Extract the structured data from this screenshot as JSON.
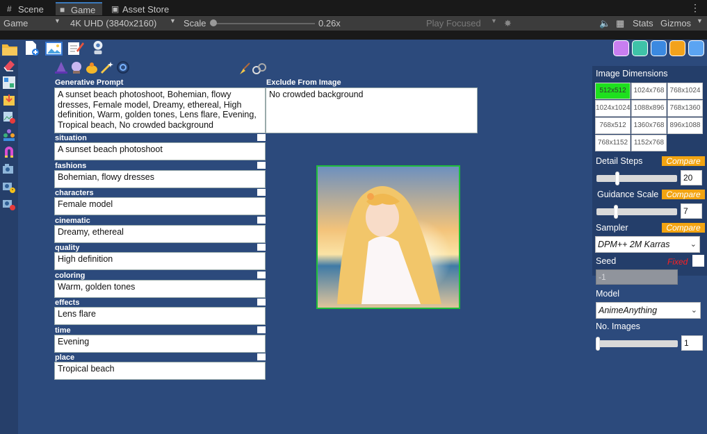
{
  "tabs": [
    {
      "label": "Scene",
      "icon": "grid-icon"
    },
    {
      "label": "Game",
      "icon": "gamepad-icon"
    },
    {
      "label": "Asset Store",
      "icon": "store-icon"
    }
  ],
  "toolbar": {
    "display": "Game",
    "resolution": "4K UHD (3840x2160)",
    "scale_label": "Scale",
    "scale_value": "0.26x",
    "play_focused": "Play Focused",
    "stats": "Stats",
    "gizmos": "Gizmos"
  },
  "prompt": {
    "title": "Generative Prompt",
    "text": "A sunset beach photoshoot, Bohemian, flowy dresses, Female model, Dreamy, ethereal, High definition, Warm, golden tones, Lens flare, Evening, Tropical beach, No crowded background"
  },
  "exclude": {
    "title": "Exclude From Image",
    "text": "No crowded background"
  },
  "fields": [
    {
      "label": "situation",
      "value": "A sunset beach photoshoot"
    },
    {
      "label": "fashions",
      "value": "Bohemian, flowy dresses"
    },
    {
      "label": "characters",
      "value": "Female model"
    },
    {
      "label": "cinematic",
      "value": "Dreamy, ethereal"
    },
    {
      "label": "quality",
      "value": "High definition"
    },
    {
      "label": "coloring",
      "value": "Warm, golden tones"
    },
    {
      "label": "effects",
      "value": "Lens flare"
    },
    {
      "label": "time",
      "value": "Evening"
    },
    {
      "label": "place",
      "value": "Tropical beach"
    }
  ],
  "settings": {
    "dimensions_title": "Image Dimensions",
    "dimensions": [
      "512x512",
      "1024x768",
      "768x1024",
      "1024x1024",
      "1088x896",
      "768x1360",
      "768x512",
      "1360x768",
      "896x1088",
      "768x1152",
      "1152x768"
    ],
    "selected_dimension": "512x512",
    "detail_steps_label": "Detail Steps",
    "detail_steps_value": "20",
    "guidance_label": "Guidance Scale",
    "guidance_value": "7",
    "compare": "Compare",
    "sampler_label": "Sampler",
    "sampler_value": "DPM++ 2M  Karras",
    "seed_label": "Seed",
    "seed_fixed": "Fixed",
    "seed_value": "-1",
    "model_label": "Model",
    "model_value": "AnimeAnything",
    "images_label": "No. Images",
    "images_value": "1",
    "accent": "#f3a411",
    "selected_color": "#1ee01e"
  }
}
